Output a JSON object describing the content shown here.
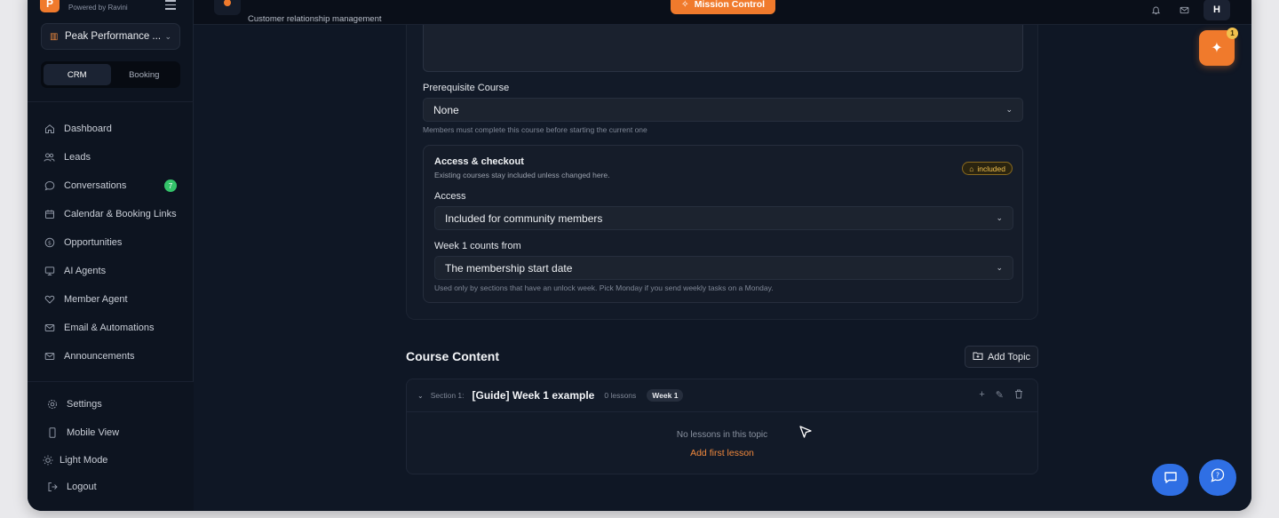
{
  "brand": {
    "logo_letter": "P",
    "sub": "Powered by Ravini"
  },
  "workspace": {
    "name": "Peak Performance ..."
  },
  "mode_toggle": {
    "options": [
      "CRM",
      "Booking"
    ],
    "active": "CRM"
  },
  "sidebar": {
    "items": [
      {
        "label": "Dashboard",
        "icon": "home-icon"
      },
      {
        "label": "Leads",
        "icon": "users-icon"
      },
      {
        "label": "Conversations",
        "icon": "chat-icon",
        "badge": "7"
      },
      {
        "label": "Calendar & Booking Links",
        "icon": "calendar-icon"
      },
      {
        "label": "Opportunities",
        "icon": "dollar-icon"
      },
      {
        "label": "AI Agents",
        "icon": "monitor-icon"
      },
      {
        "label": "Member Agent",
        "icon": "heart-icon"
      },
      {
        "label": "Email & Automations",
        "icon": "mail-icon"
      },
      {
        "label": "Announcements",
        "icon": "mail-icon"
      }
    ],
    "bottom": [
      {
        "label": "Settings",
        "icon": "gear-icon"
      },
      {
        "label": "Mobile View",
        "icon": "phone-icon"
      },
      {
        "label": "Light Mode",
        "icon": "sun-icon"
      },
      {
        "label": "Logout",
        "icon": "logout-icon"
      }
    ]
  },
  "header": {
    "subtitle": "Customer relationship management",
    "mission_control": "Mission Control",
    "avatar": "H"
  },
  "form": {
    "prereq_label": "Prerequisite Course",
    "prereq_value": "None",
    "prereq_hint": "Members must complete this course before starting the current one",
    "access_title": "Access & checkout",
    "access_sub": "Existing courses stay included unless changed here.",
    "access_pill": "included",
    "access_label": "Access",
    "access_value": "Included for community members",
    "week_label": "Week 1 counts from",
    "week_value": "The membership start date",
    "week_hint": "Used only by sections that have an unlock week. Pick Monday if you send weekly tasks on a Monday."
  },
  "content": {
    "title": "Course Content",
    "add_topic": "Add Topic",
    "topic": {
      "section": "Section 1:",
      "name": "[Guide] Week 1 example",
      "count": "0 lessons",
      "week": "Week 1",
      "empty": "No lessons in this topic",
      "add_first": "Add first lesson"
    }
  },
  "fab": {
    "badge": "1"
  },
  "colors": {
    "accent": "#f07a2c",
    "blue": "#2f6fe4",
    "green": "#34c36a"
  }
}
